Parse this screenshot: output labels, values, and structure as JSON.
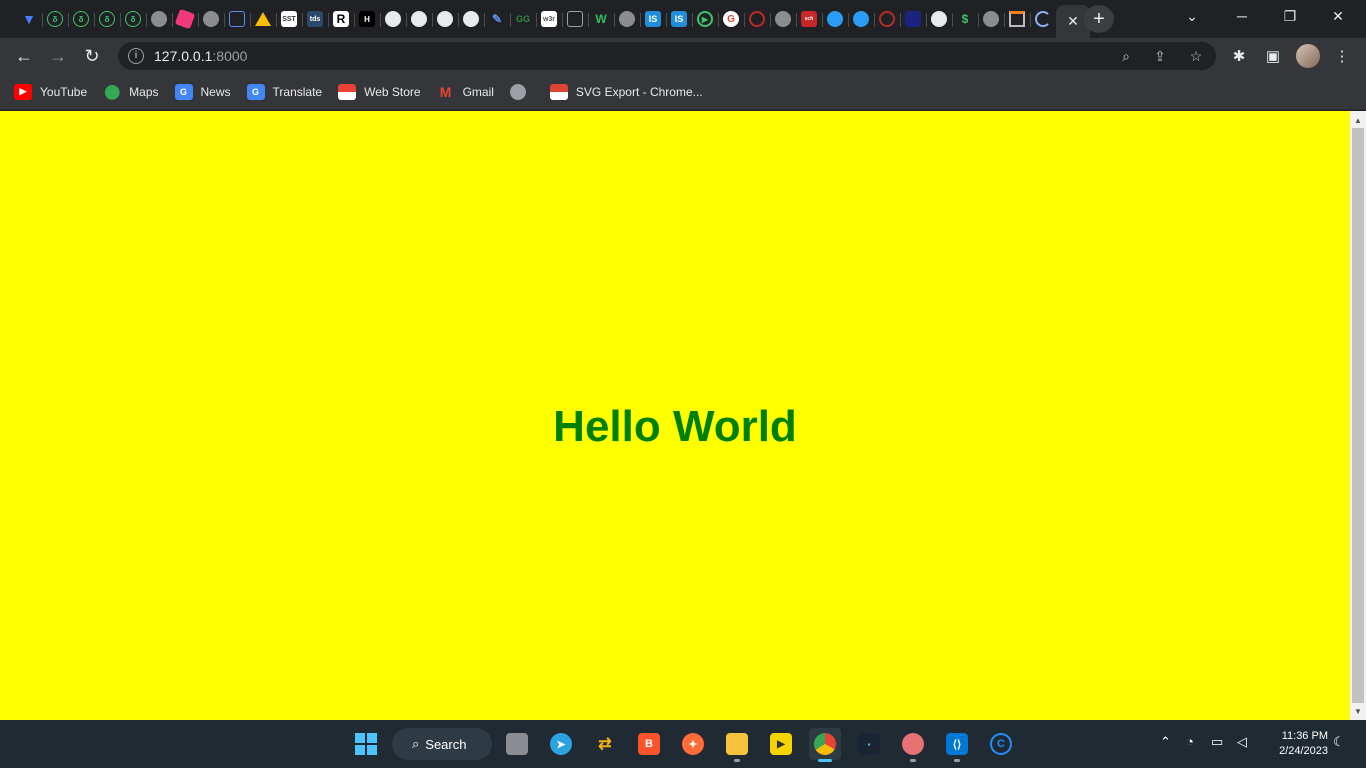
{
  "browser": {
    "active_tab_close": "✕",
    "new_tab": "+",
    "window_controls": {
      "tab_search": "⌄",
      "minimize": "─",
      "restore": "❐",
      "close": "✕"
    }
  },
  "toolbar": {
    "back": "←",
    "forward": "→",
    "reload": "↻",
    "url_host": "127.0.0.1",
    "url_port": ":8000"
  },
  "bookmarks": [
    {
      "label": "YouTube",
      "icon": "youtube-icon",
      "color": "#ff0000"
    },
    {
      "label": "Maps",
      "icon": "maps-icon",
      "color": "#34a853"
    },
    {
      "label": "News",
      "icon": "news-icon",
      "color": "#4285f4"
    },
    {
      "label": "Translate",
      "icon": "translate-icon",
      "color": "#4285f4"
    },
    {
      "label": "Web Store",
      "icon": "webstore-icon",
      "color": "#ea4335"
    },
    {
      "label": "Gmail",
      "icon": "gmail-icon",
      "color": "#ea4335"
    },
    {
      "label": "",
      "icon": "globe-icon",
      "color": "#9aa0a6"
    },
    {
      "label": "SVG Export - Chrome...",
      "icon": "svg-export-icon",
      "color": "#db4437"
    }
  ],
  "page": {
    "heading": "Hello World",
    "background": "#ffff00",
    "heading_color": "#008000"
  },
  "taskbar": {
    "search_label": "Search",
    "time": "11:36 PM",
    "date": "2/24/2023"
  }
}
